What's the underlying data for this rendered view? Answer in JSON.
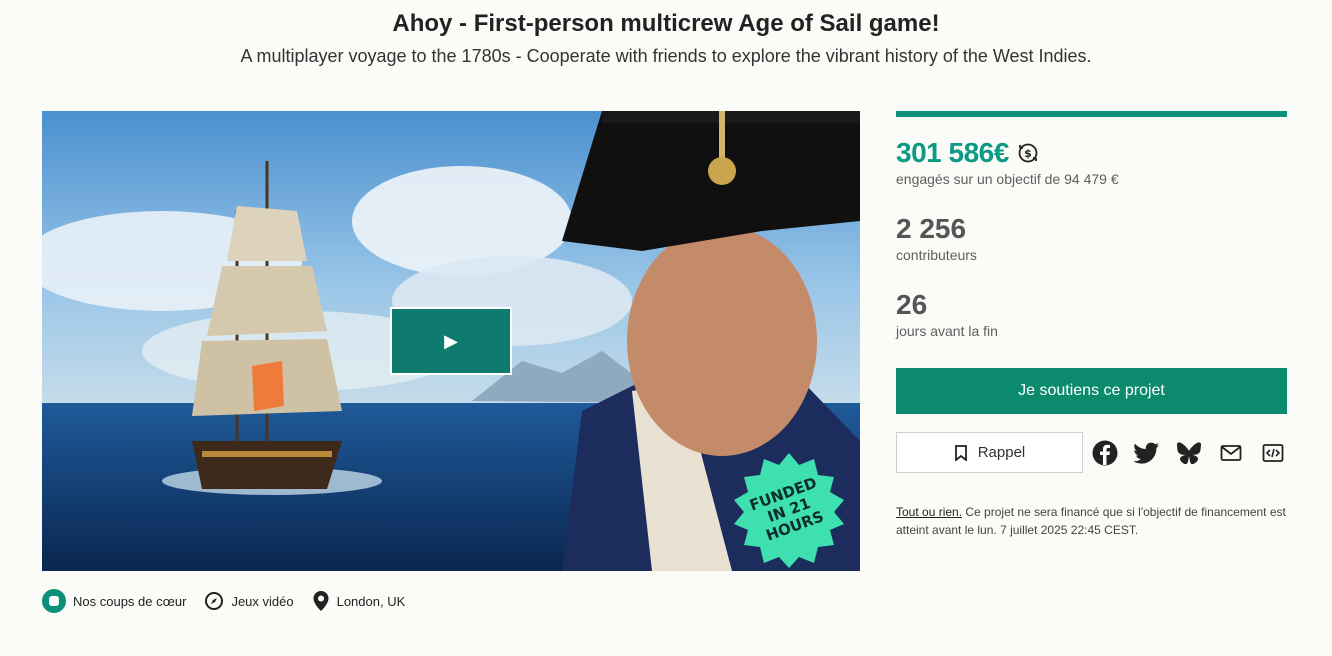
{
  "header": {
    "title": "Ahoy - First-person multicrew Age of Sail game!",
    "subtitle": "A multiplayer voyage to the 1780s - Cooperate with friends to explore the vibrant history of the West Indies."
  },
  "video": {
    "play_icon": "play-icon",
    "badge_lines": [
      "FUNDED",
      "IN 21",
      "HOURS"
    ]
  },
  "tags": [
    {
      "icon": "favorite-badge-icon",
      "label": "Nos coups de cœur"
    },
    {
      "icon": "compass-icon",
      "label": "Jeux vidéo"
    },
    {
      "icon": "location-pin-icon",
      "label": "London, UK"
    }
  ],
  "funding": {
    "progress_fraction": 1.0,
    "amount": "301 586€",
    "amount_icon": "currency-exchange-icon",
    "goal_text": "engagés sur un objectif de 94 479 €",
    "backers_count": "2 256",
    "backers_label": "contributeurs",
    "days_count": "26",
    "days_label": "jours avant la fin"
  },
  "actions": {
    "support_label": "Je soutiens ce projet",
    "reminder_label": "Rappel",
    "share": [
      "facebook-icon",
      "twitter-icon",
      "bluesky-icon",
      "email-icon",
      "embed-code-icon"
    ]
  },
  "notice": {
    "link_text": "Tout ou rien.",
    "text": " Ce projet ne sera financé que si l'objectif de financement est atteint avant le lun. 7 juillet 2025 22:45 CEST."
  },
  "colors": {
    "accent": "#0d9a85",
    "button": "#0c8a6e",
    "badge": "#3ee0b0"
  }
}
